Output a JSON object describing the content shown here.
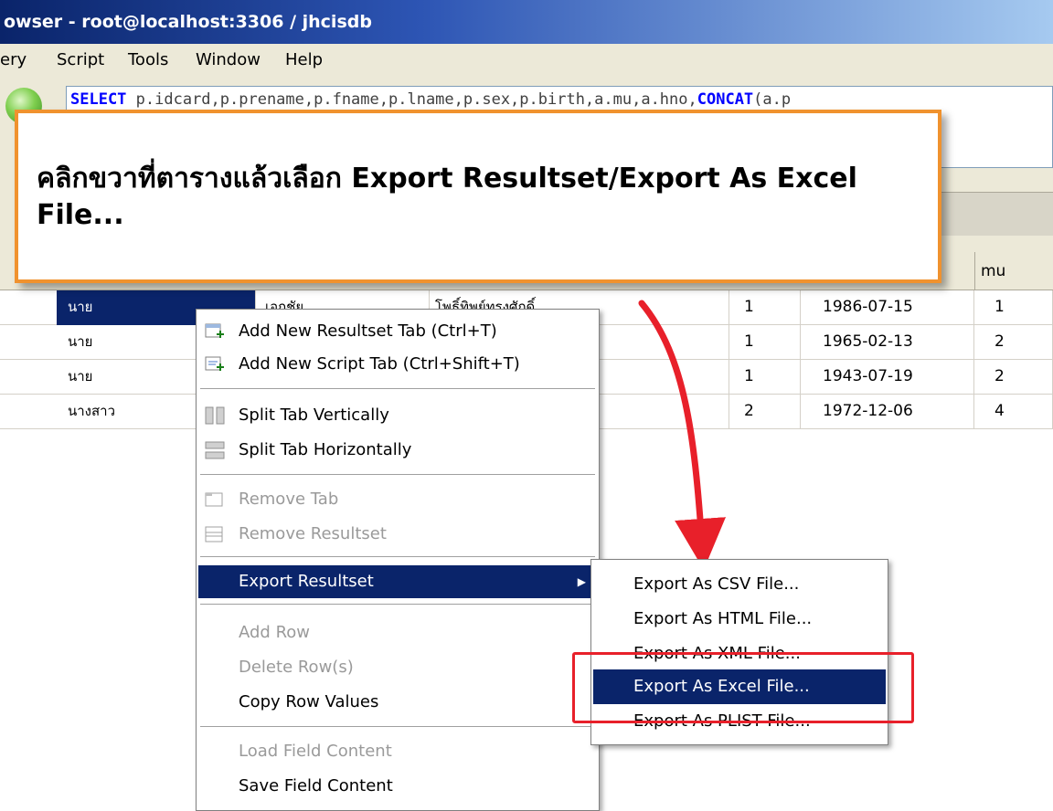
{
  "window": {
    "title": "owser - root@localhost:3306 / jhcisdb"
  },
  "menubar": {
    "items": [
      "ery",
      "Script",
      "Tools",
      "Window",
      "Help"
    ]
  },
  "query": {
    "kw1": "SELECT",
    "mid": " p.idcard,p.prename,p.fname,p.lname,p.sex,p.birth,a.mu,a.hno,",
    "kw2": "CONCAT",
    "tail": "(a.p"
  },
  "grid": {
    "mu_header": "mu",
    "rows": [
      {
        "prename": "นาย",
        "fname": "เอกชัย",
        "lname": "โพธิ์ทิพย์ทรงศักดิ์",
        "sex": "1",
        "birth": "1986-07-15",
        "mu": "1"
      },
      {
        "prename": "นาย",
        "fname": "",
        "lname": "",
        "sex": "1",
        "birth": "1965-02-13",
        "mu": "2"
      },
      {
        "prename": "นาย",
        "fname": "",
        "lname": "",
        "sex": "1",
        "birth": "1943-07-19",
        "mu": "2"
      },
      {
        "prename": "นางสาว",
        "fname": "",
        "lname": "",
        "sex": "2",
        "birth": "1972-12-06",
        "mu": "4"
      }
    ]
  },
  "callout": {
    "text": "คลิกขวาที่ตารางแล้วเลือก Export Resultset/Export As Excel File..."
  },
  "context_menu": {
    "add_resultset_tab": "Add New Resultset Tab (Ctrl+T)",
    "add_script_tab": "Add New Script Tab (Ctrl+Shift+T)",
    "split_vertical": "Split Tab Vertically",
    "split_horizontal": "Split Tab Horizontally",
    "remove_tab": "Remove Tab",
    "remove_resultset": "Remove Resultset",
    "export_resultset": "Export Resultset",
    "add_row": "Add Row",
    "delete_rows": "Delete Row(s)",
    "copy_row_values": "Copy Row Values",
    "load_field_content": "Load Field Content",
    "save_field_content": "Save Field Content"
  },
  "export_submenu": {
    "csv": "Export As CSV File...",
    "html": "Export As HTML File...",
    "xml": "Export As XML File...",
    "excel": "Export As Excel File...",
    "plist": "Export As PLIST File..."
  },
  "colors": {
    "selection": "#0a246a",
    "callout_border": "#f0922e",
    "annotation_red": "#e8202a"
  }
}
